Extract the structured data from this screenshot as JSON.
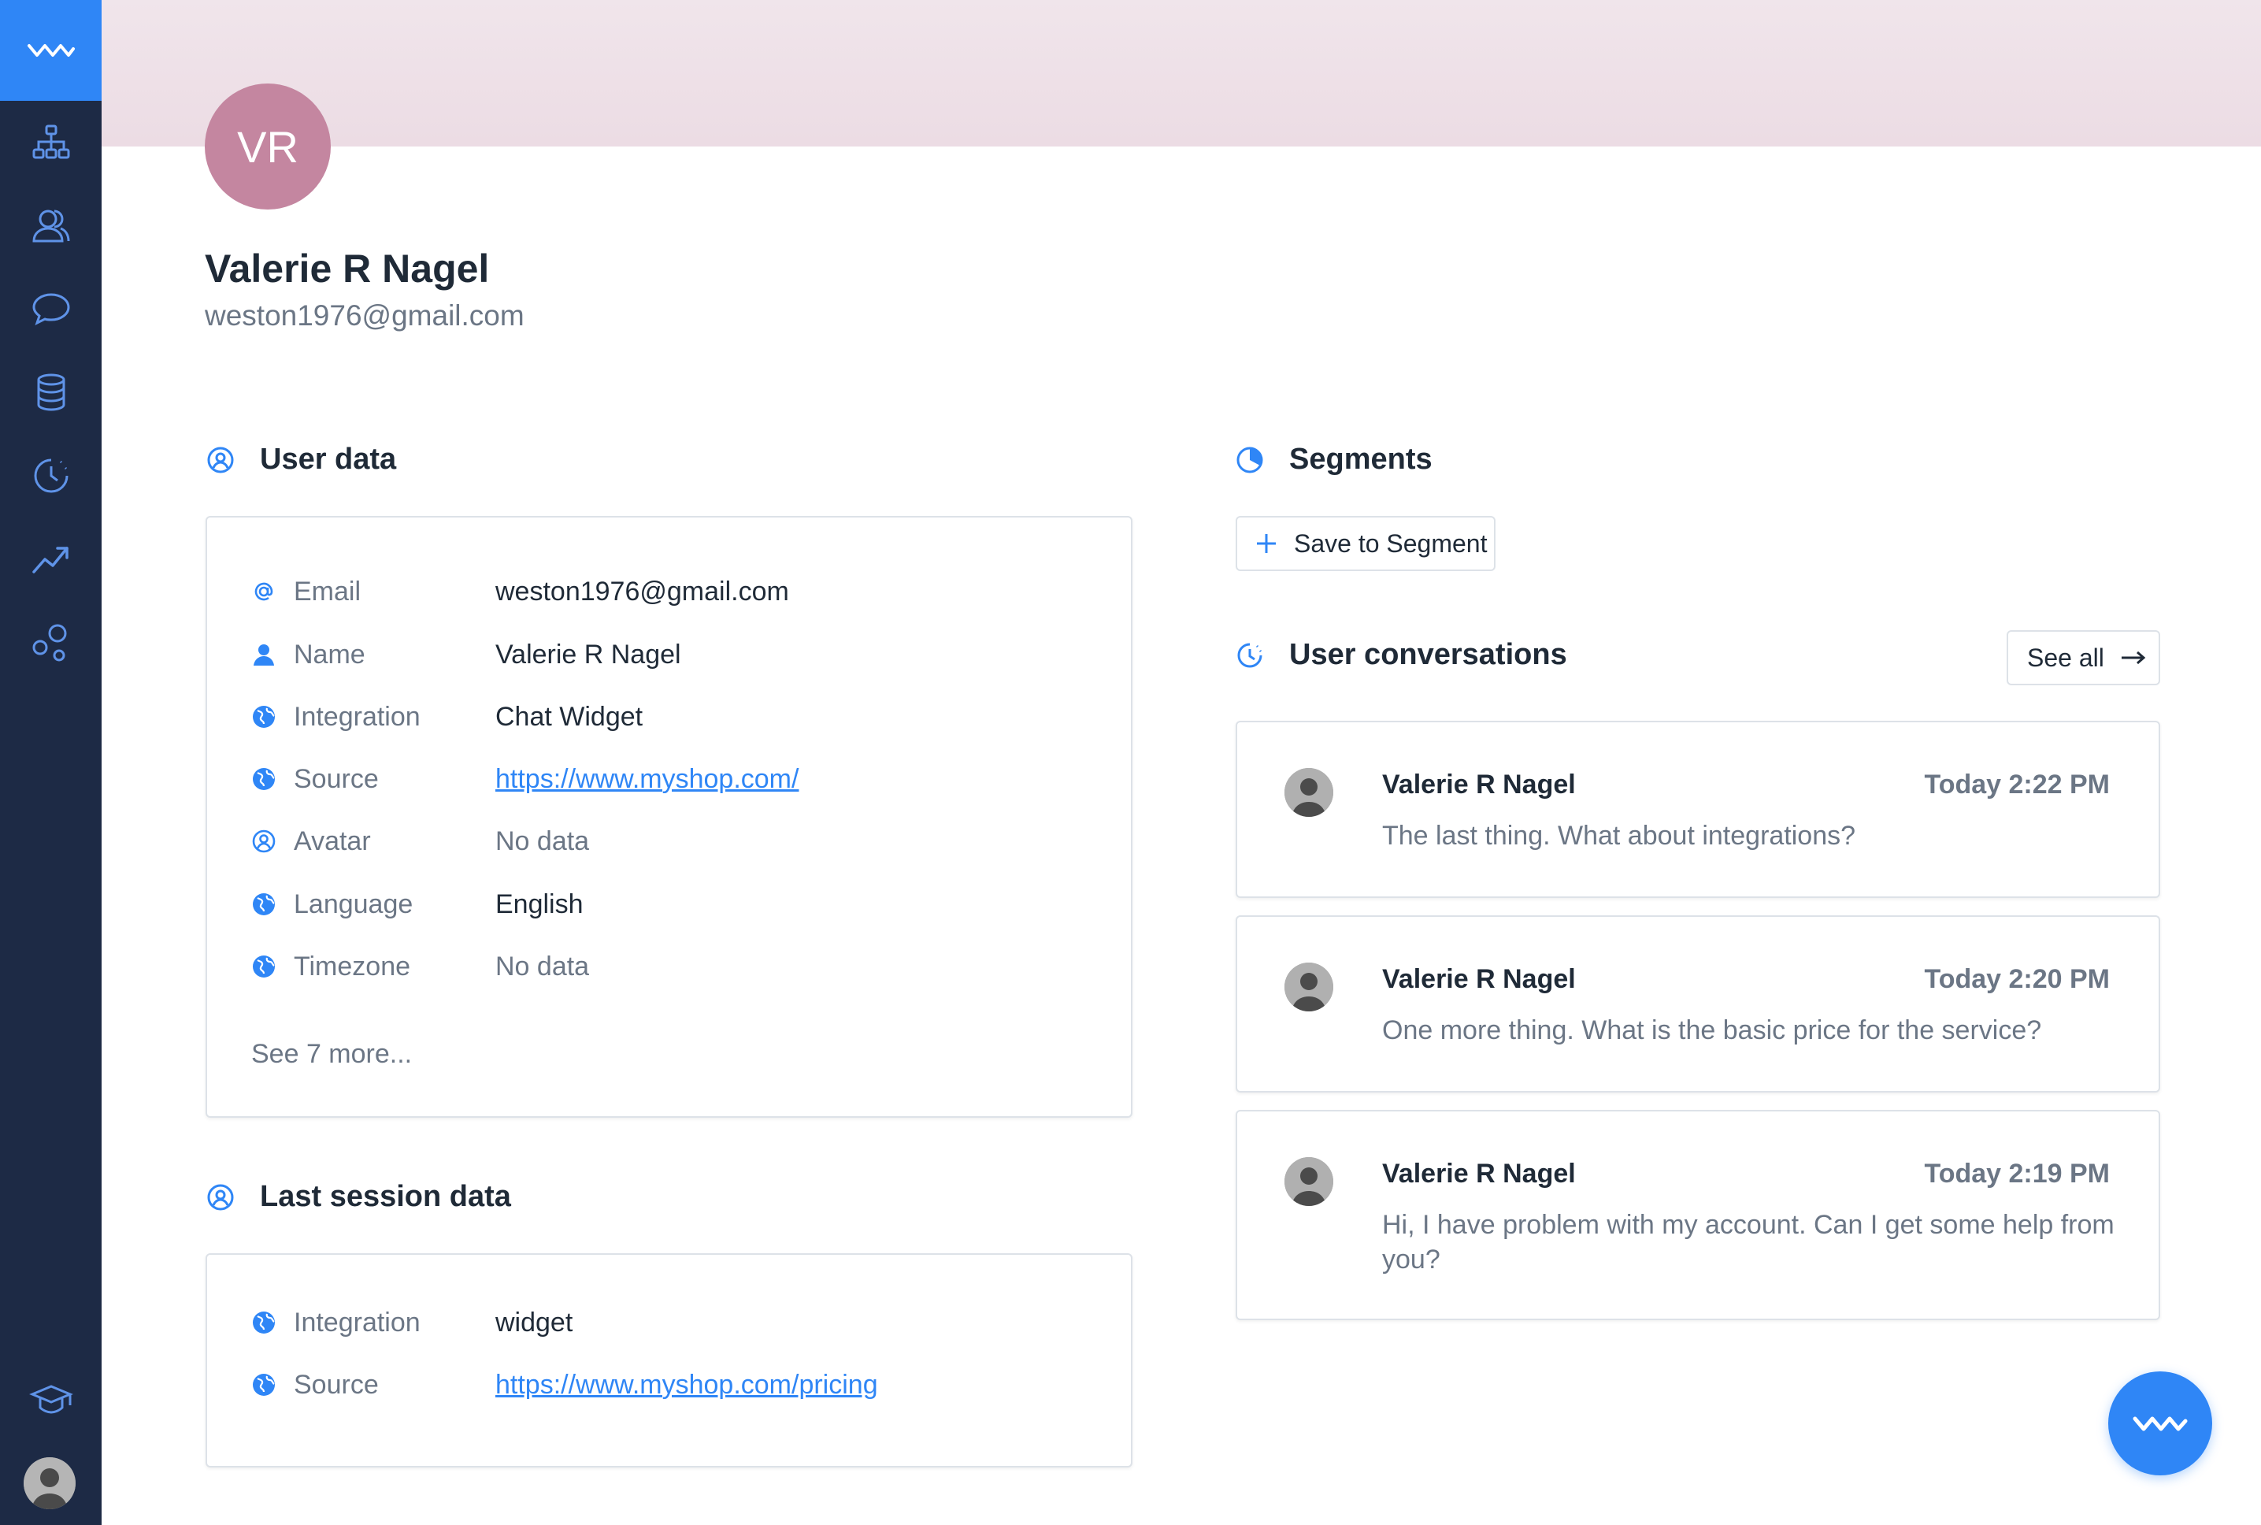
{
  "sidebar": {
    "items": [
      "logo-icon",
      "hierarchy-icon",
      "users-icon",
      "chat-icon",
      "database-icon",
      "history-icon",
      "trending-icon",
      "bubbles-icon",
      "graduation-cap-icon"
    ]
  },
  "profile": {
    "initials": "VR",
    "name": "Valerie R Nagel",
    "email": "weston1976@gmail.com"
  },
  "user_data": {
    "title": "User data",
    "rows": [
      {
        "icon": "at-icon",
        "label": "Email",
        "value": "weston1976@gmail.com"
      },
      {
        "icon": "person-icon",
        "label": "Name",
        "value": "Valerie R Nagel"
      },
      {
        "icon": "globe-icon",
        "label": "Integration",
        "value": "Chat Widget"
      },
      {
        "icon": "globe-icon",
        "label": "Source",
        "value": "https://www.myshop.com/"
      },
      {
        "icon": "user-circle-icon",
        "label": "Avatar",
        "value": "No data"
      },
      {
        "icon": "globe-icon",
        "label": "Language",
        "value": "English"
      },
      {
        "icon": "globe-icon",
        "label": "Timezone",
        "value": "No data"
      }
    ],
    "see_more": "See 7 more..."
  },
  "last_session": {
    "title": "Last session data",
    "rows": [
      {
        "icon": "globe-icon",
        "label": "Integration",
        "value": "widget"
      },
      {
        "icon": "globe-icon",
        "label": "Source",
        "value": "https://www.myshop.com/pricing"
      }
    ]
  },
  "segments": {
    "title": "Segments",
    "save_button": "Save to Segment"
  },
  "conversations": {
    "title": "User conversations",
    "see_all": "See all",
    "items": [
      {
        "name": "Valerie R Nagel",
        "time": "Today 2:22 PM",
        "message": "The last thing. What about integrations?"
      },
      {
        "name": "Valerie R Nagel",
        "time": "Today 2:20 PM",
        "message": "One more thing. What is the basic price for the service?"
      },
      {
        "name": "Valerie R Nagel",
        "time": "Today 2:19 PM",
        "message": "Hi, I have problem with my account. Can I get some help from you?"
      }
    ]
  },
  "colors": {
    "sidebar": "#1d2a45",
    "accent": "#2f86f6",
    "avatar": "#c486a0",
    "banner": "#ecdce4"
  }
}
